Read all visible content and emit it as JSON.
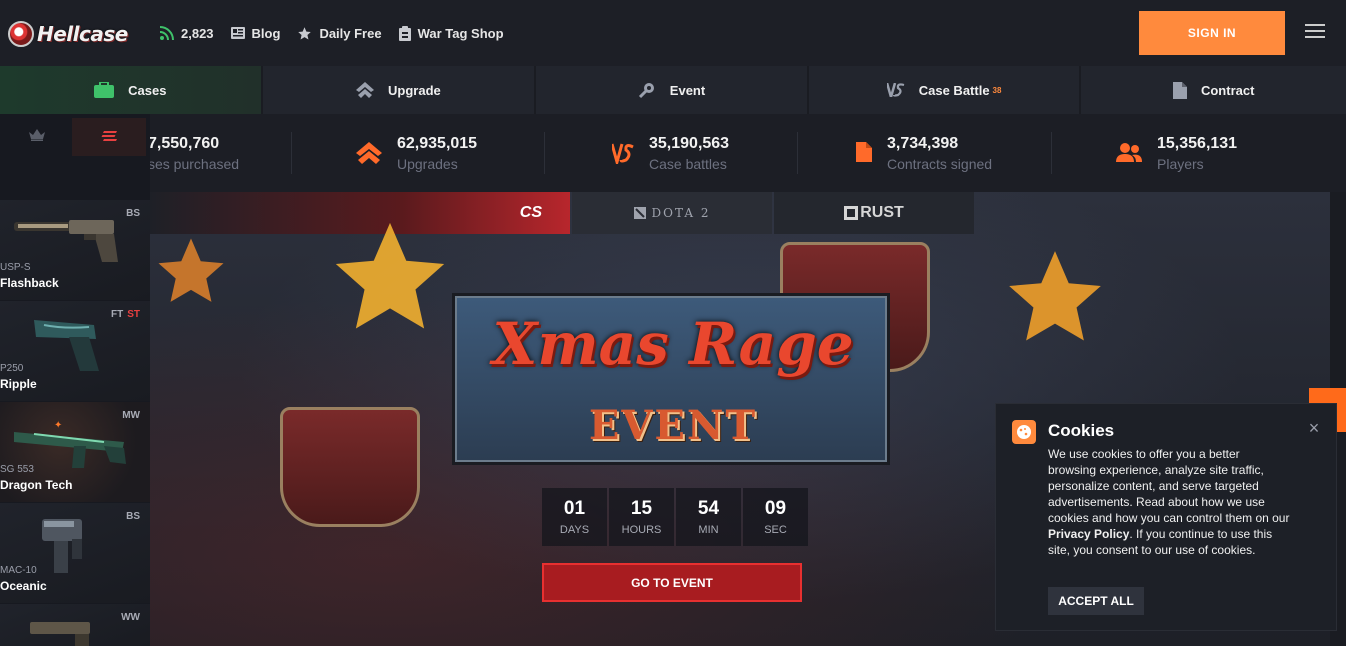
{
  "header": {
    "logo_text": "Hellcase",
    "online_count": "2,823",
    "links": [
      {
        "label": "Blog",
        "icon": "blog-icon"
      },
      {
        "label": "Daily Free",
        "icon": "star-icon"
      },
      {
        "label": "War Tag Shop",
        "icon": "shop-icon"
      }
    ],
    "signin_label": "SIGN IN"
  },
  "nav_tabs": [
    {
      "label": "Cases",
      "icon": "briefcase-icon",
      "active": true
    },
    {
      "label": "Upgrade",
      "icon": "upgrade-icon"
    },
    {
      "label": "Event",
      "icon": "event-icon"
    },
    {
      "label": "Case Battle",
      "icon": "versus-icon",
      "badge": "38"
    },
    {
      "label": "Contract",
      "icon": "document-icon"
    }
  ],
  "stats": [
    {
      "value": "7,550,760",
      "label": "ses purchased"
    },
    {
      "value": "62,935,015",
      "label": "Upgrades"
    },
    {
      "value": "35,190,563",
      "label": "Case battles"
    },
    {
      "value": "3,734,398",
      "label": "Contracts signed"
    },
    {
      "value": "15,356,131",
      "label": "Players"
    }
  ],
  "live_drops": [
    {
      "quality": "BS",
      "stattrak": "",
      "type": "USP-S",
      "name": "Flashback"
    },
    {
      "quality": "FT",
      "stattrak": "ST",
      "type": "P250",
      "name": "Ripple"
    },
    {
      "quality": "MW",
      "stattrak": "",
      "type": "SG 553",
      "name": "Dragon Tech"
    },
    {
      "quality": "BS",
      "stattrak": "",
      "type": "MAC-10",
      "name": "Oceanic"
    },
    {
      "quality": "WW",
      "stattrak": "",
      "type": "",
      "name": ""
    }
  ],
  "game_tabs": [
    {
      "label": "CS",
      "active": true
    },
    {
      "label": "DOTA 2"
    },
    {
      "label": "RUST"
    }
  ],
  "event": {
    "title_line1": "Xmas Rage",
    "title_line2": "EVENT",
    "countdown": [
      {
        "value": "01",
        "unit": "DAYS"
      },
      {
        "value": "15",
        "unit": "HOURS"
      },
      {
        "value": "54",
        "unit": "MIN"
      },
      {
        "value": "09",
        "unit": "SEC"
      }
    ],
    "button_label": "GO TO EVENT"
  },
  "cookies": {
    "title": "Cookies",
    "text_part1": "We use cookies to offer you a better browsing experience, analyze site traffic, personalize content, and serve targeted advertisements. Read about how we use cookies and how you can control them on our ",
    "privacy_link": "Privacy Policy",
    "text_part2": ". If you continue to use this site, you consent to our use of cookies.",
    "accept_label": "ACCEPT ALL",
    "close_label": "×"
  },
  "colors": {
    "accent_orange": "#ff8a3d",
    "event_red": "#a81c20",
    "background": "#1a1c22"
  }
}
